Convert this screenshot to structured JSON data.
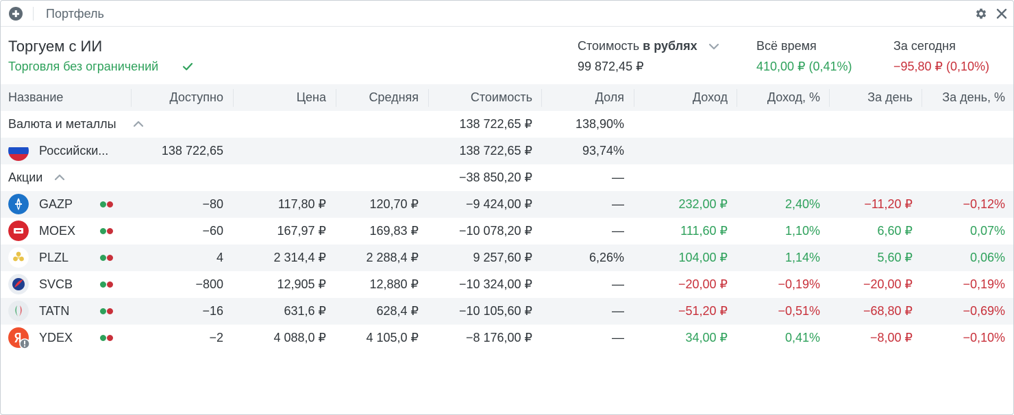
{
  "titlebar": {
    "title": "Портфель"
  },
  "account": {
    "name": "Торгуем с ИИ",
    "status": "Торговля без ограничений"
  },
  "summary": {
    "value_label_prefix": "Стоимость",
    "value_label_bold": "в рублях",
    "value": "99 872,45 ₽",
    "alltime_label": "Всё время",
    "alltime_value": "410,00 ₽ (0,41%)",
    "today_label": "За сегодня",
    "today_value": "−95,80 ₽ (0,10%)"
  },
  "colors": {
    "positive": "#2ea15b",
    "negative": "#c8303a",
    "accent": "#2ea15b"
  },
  "table": {
    "columns": [
      "Название",
      "Доступно",
      "Цена",
      "Средняя",
      "Стоимость",
      "Доля",
      "Доход",
      "Доход, %",
      "За день",
      "За день, %"
    ],
    "groups": [
      {
        "label": "Валюта и металлы",
        "value": "138 722,65 ₽",
        "share": "138,90%"
      },
      {
        "label": "Акции",
        "value": "−38 850,20 ₽",
        "share": "—"
      }
    ],
    "currency_row": {
      "name": "Российски...",
      "available": "138 722,65",
      "value": "138 722,65 ₽",
      "share": "93,74%",
      "icon": "russian-flag-icon"
    },
    "rows": [
      {
        "ticker": "GAZP",
        "icon": "gazprom-logo",
        "available": "−80",
        "price": "117,80 ₽",
        "avg": "120,70 ₽",
        "value": "−9 424,00 ₽",
        "share": "—",
        "income": "232,00 ₽",
        "income_pct": "2,40%",
        "day": "−11,20 ₽",
        "day_pct": "−0,12%",
        "income_sign": "pos",
        "day_sign": "neg",
        "daypct_sign": "neg"
      },
      {
        "ticker": "MOEX",
        "icon": "moex-logo",
        "available": "−60",
        "price": "167,97 ₽",
        "avg": "169,83 ₽",
        "value": "−10 078,20 ₽",
        "share": "—",
        "income": "111,60 ₽",
        "income_pct": "1,10%",
        "day": "6,60 ₽",
        "day_pct": "0,07%",
        "income_sign": "pos",
        "day_sign": "pos",
        "daypct_sign": "pos"
      },
      {
        "ticker": "PLZL",
        "icon": "polyus-logo",
        "available": "4",
        "price": "2 314,4 ₽",
        "avg": "2 288,4 ₽",
        "value": "9 257,60 ₽",
        "share": "6,26%",
        "income": "104,00 ₽",
        "income_pct": "1,14%",
        "day": "5,60 ₽",
        "day_pct": "0,06%",
        "income_sign": "pos",
        "day_sign": "pos",
        "daypct_sign": "pos"
      },
      {
        "ticker": "SVCB",
        "icon": "sovcombank-logo",
        "available": "−800",
        "price": "12,905 ₽",
        "avg": "12,880 ₽",
        "value": "−10 324,00 ₽",
        "share": "—",
        "income": "−20,00 ₽",
        "income_pct": "−0,19%",
        "day": "−20,00 ₽",
        "day_pct": "−0,19%",
        "income_sign": "neg",
        "day_sign": "neg",
        "daypct_sign": "neg"
      },
      {
        "ticker": "TATN",
        "icon": "tatneft-logo",
        "available": "−16",
        "price": "631,6 ₽",
        "avg": "628,4 ₽",
        "value": "−10 105,60 ₽",
        "share": "—",
        "income": "−51,20 ₽",
        "income_pct": "−0,51%",
        "day": "−68,80 ₽",
        "day_pct": "−0,69%",
        "income_sign": "neg",
        "day_sign": "neg",
        "daypct_sign": "neg"
      },
      {
        "ticker": "YDEX",
        "icon": "yandex-logo",
        "available": "−2",
        "price": "4 088,0 ₽",
        "avg": "4 105,0 ₽",
        "value": "−8 176,00 ₽",
        "share": "—",
        "income": "34,00 ₽",
        "income_pct": "0,41%",
        "day": "−8,00 ₽",
        "day_pct": "−0,10%",
        "income_sign": "pos",
        "day_sign": "neg",
        "daypct_sign": "neg"
      }
    ]
  }
}
